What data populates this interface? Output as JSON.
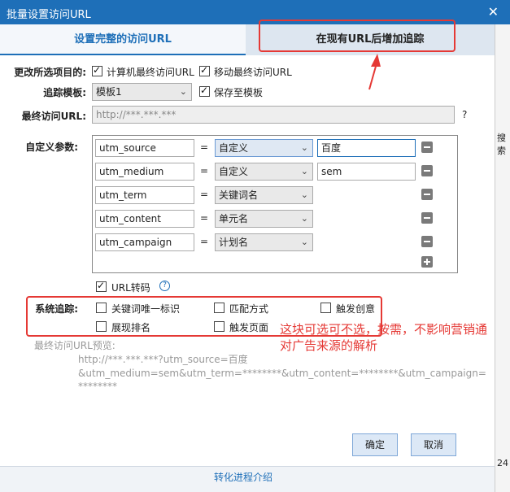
{
  "window": {
    "title": "批量设置访问URL",
    "close_glyph": "✕"
  },
  "tabs": [
    {
      "label": "设置完整的访问URL"
    },
    {
      "label": "在现有URL后增加追踪"
    }
  ],
  "form": {
    "change_target_label": "更改所选项目的:",
    "pc_url_label": "计算机最终访问URL",
    "mobile_url_label": "移动最终访问URL",
    "template_label": "追踪模板:",
    "template_value": "模板1",
    "save_template_label": "保存至模板",
    "final_url_label": "最终访问URL:",
    "final_url_placeholder": "http://***.***.***",
    "help_glyph": "?",
    "custom_params_label": "自定义参数:",
    "params": [
      {
        "key": "utm_source",
        "eq": "=",
        "type": "自定义",
        "value": "百度"
      },
      {
        "key": "utm_medium",
        "eq": "=",
        "type": "自定义",
        "value": "sem"
      },
      {
        "key": "utm_term",
        "eq": "=",
        "type": "关键词名",
        "value": ""
      },
      {
        "key": "utm_content",
        "eq": "=",
        "type": "单元名",
        "value": ""
      },
      {
        "key": "utm_campaign",
        "eq": "=",
        "type": "计划名",
        "value": ""
      }
    ],
    "url_transcode_label": "URL转码",
    "system_track_label": "系统追踪:",
    "track_keyword_id": "关键词唯一标识",
    "track_match_type": "匹配方式",
    "track_trigger_creative": "触发创意",
    "track_show_rank": "展现排名",
    "track_trigger_page": "触发页面",
    "preview_label": "最终访问URL预览:",
    "preview_line1": "http://***.***.***?utm_source=百度",
    "preview_line2": "&utm_medium=sem&utm_term=********&utm_content=********&utm_campaign=",
    "preview_line3": "********"
  },
  "annotation": {
    "text_line1": "这块可选可不选，按需，不影响营销通",
    "text_line2": "对广告来源的解析",
    "color": "#e53935"
  },
  "buttons": {
    "ok": "确定",
    "cancel": "取消"
  },
  "bottom": {
    "link": "转化进程介绍"
  },
  "right_strip": {
    "text1": "搜索",
    "text2": "24"
  }
}
